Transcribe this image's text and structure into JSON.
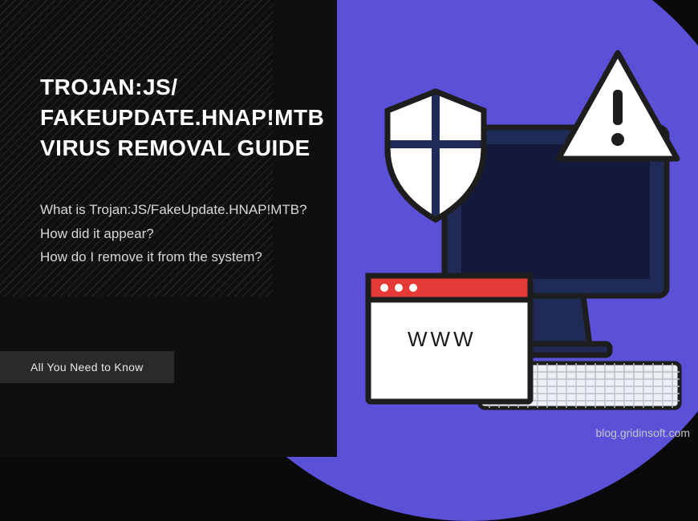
{
  "heading": {
    "line1": "TROJAN:JS/",
    "line2": "FAKEUPDATE.HNAP!MTB",
    "line3": "VIRUS REMOVAL GUIDE"
  },
  "questions": {
    "q1": "What is Trojan:JS/FakeUpdate.HNAP!MTB?",
    "q2": "How did it appear?",
    "q3": "How do I remove it from the system?"
  },
  "badge_label": "All You Need to Know",
  "browser_label": "WWW",
  "footer_url": "blog.gridinsoft.com",
  "colors": {
    "background_dark": "#0f0f0f",
    "circle_purple": "#5b51d8",
    "badge_bg": "#2a2a2a",
    "shield_blue": "#1f2a57",
    "browser_red": "#e53935"
  }
}
